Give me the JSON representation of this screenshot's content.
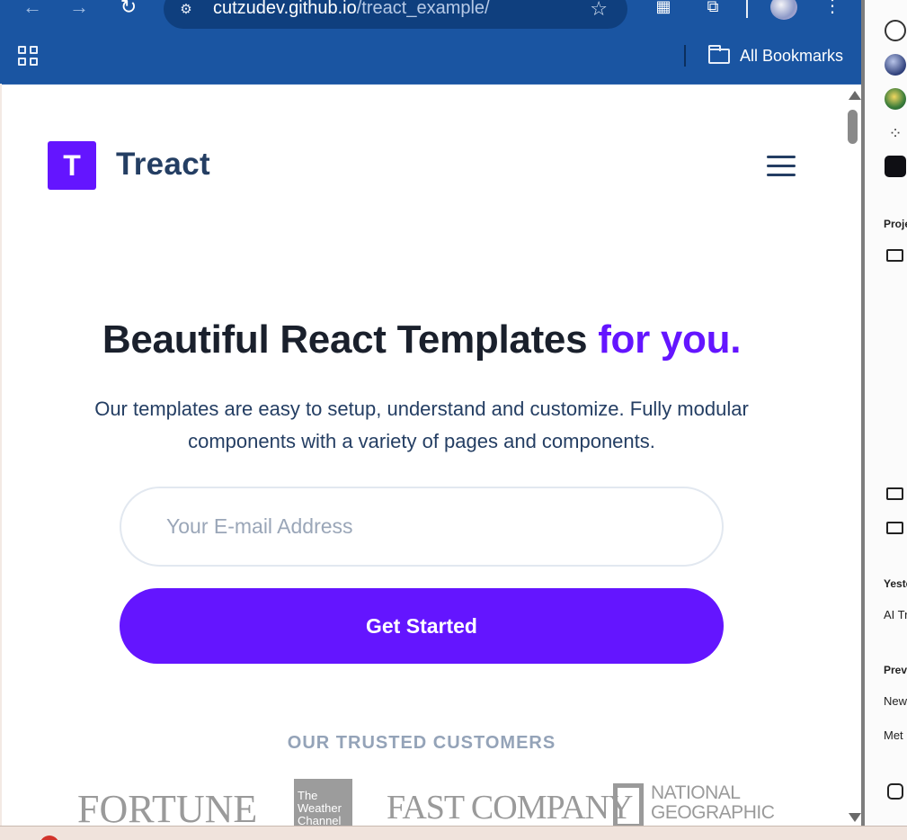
{
  "browser": {
    "url_host": "cutzudev.github.io",
    "url_path": "/treact_example/",
    "bookmarks_label": "All Bookmarks"
  },
  "page": {
    "logo_letter": "T",
    "brand": "Treact",
    "headline_main": "Beautiful React Templates ",
    "headline_accent": "for you.",
    "subtext": "Our templates are easy to setup, understand and customize. Fully modular components with a variety of pages and components.",
    "email_placeholder": "Your E-mail Address",
    "cta_label": "Get Started",
    "customers_label": "OUR TRUSTED CUSTOMERS",
    "customers": {
      "fortune": "FORTUNE",
      "weather": "The Weather Channel",
      "fastco": "FAST COMPANY",
      "natgeo_line1": "NATIONAL",
      "natgeo_line2": "GEOGRAPHIC"
    }
  },
  "side_panel": {
    "section_projects": "Proje",
    "section_yesterday": "Yeste",
    "item_ai": "AI Tr",
    "section_previous": "Prev",
    "item_new": "New",
    "item_met": "Met"
  },
  "colors": {
    "accent": "#6415ff",
    "chrome": "#1a55a2",
    "brand_text": "#243e63"
  }
}
